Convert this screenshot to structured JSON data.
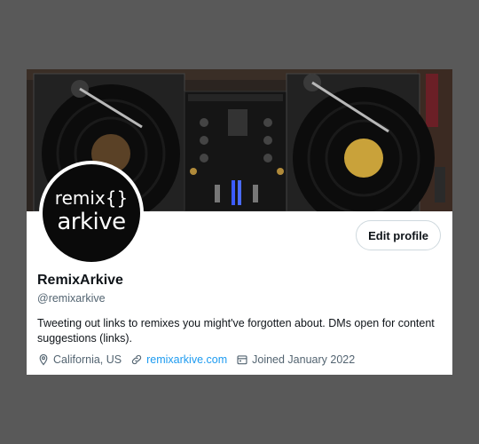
{
  "profile": {
    "avatar_line1": "remix{}",
    "avatar_line2": "arkive",
    "edit_button_label": "Edit profile",
    "display_name": "RemixArkive",
    "handle": "@remixarkive",
    "bio": "Tweeting out links to remixes you might've forgotten about.  DMs open for content suggestions (links).",
    "location": "California, US",
    "website": "remixarkive.com",
    "joined": "Joined January 2022"
  },
  "icons": {
    "location": "location-pin-icon",
    "link": "link-icon",
    "calendar": "calendar-icon"
  },
  "colors": {
    "link": "#1d9bf0",
    "secondary_text": "#536471",
    "primary_text": "#0f1419",
    "background": "#595959"
  }
}
